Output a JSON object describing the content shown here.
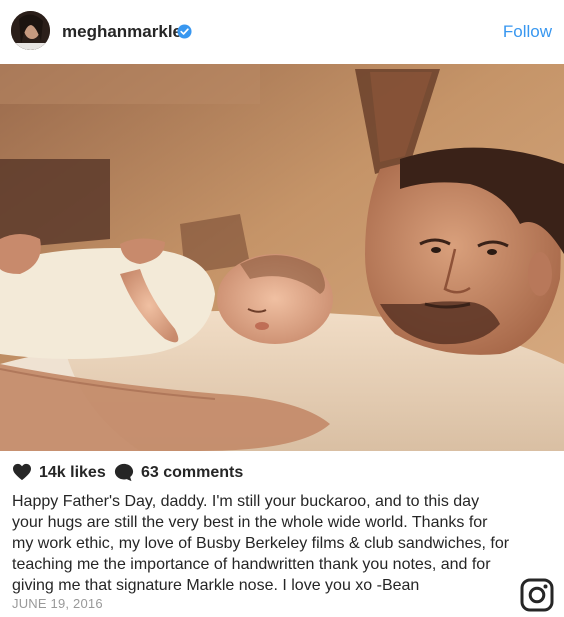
{
  "post": {
    "username": "meghanmarkle",
    "follow_label": "Follow",
    "likes": "14k likes",
    "comments": "63 comments",
    "caption": "Happy Father's Day, daddy. I'm still your buckaroo, and to this day\nyour hugs are still the very best in the whole wide world. Thanks for\nmy work ethic, my love of Busby Berkeley films & club sandwiches, for\nteaching me the importance of handwritten thank you notes, and for\ngiving me that signature Markle nose. I love you xo -Bean",
    "date": "JUNE 19, 2016"
  },
  "icons": {
    "verified": "verified-badge-icon",
    "like": "heart-icon",
    "comment": "comment-bubble-icon",
    "brand": "instagram-logo-icon"
  },
  "colors": {
    "accent": "#3897f0",
    "text": "#262626",
    "muted": "#999999",
    "photo_tone": "#c8946a"
  }
}
